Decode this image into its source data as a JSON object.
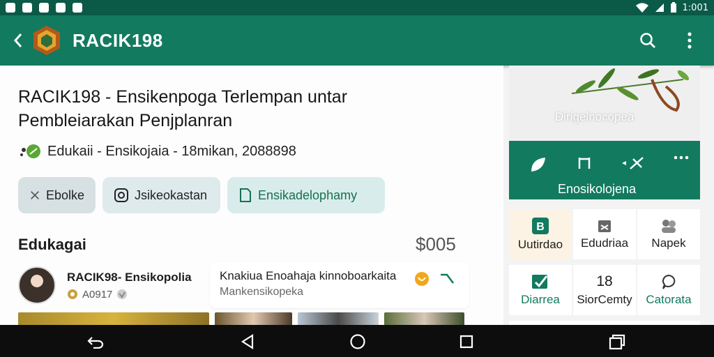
{
  "status_bar": {
    "time": "1:001",
    "colors": {
      "background": "#0a5a47"
    },
    "icons": [
      "notification-icon",
      "wifi-icon",
      "signal-icon",
      "battery-icon"
    ]
  },
  "app_bar": {
    "title": "RACIK198",
    "colors": {
      "background": "#127a5f"
    },
    "icons": [
      "back-icon",
      "app-logo",
      "search-icon",
      "more-vert-icon"
    ]
  },
  "main": {
    "headline": "RACIK198 - Ensikenpoga Terlempan untar Pembleiarakan Penjplanran",
    "meta": "Edukaii - Ensikojaia - 18mikan, 2088898",
    "chips": [
      {
        "label": "Ebolke",
        "icon": "tools-icon"
      },
      {
        "label": "Jsikeokastan",
        "icon": "instagram-icon"
      },
      {
        "label": "Ensikadelophamy",
        "icon": "document-icon"
      }
    ],
    "section": {
      "title": "Edukagai",
      "count": "$005"
    },
    "post": {
      "author": "RACIK98- Ensikopolia",
      "sub": "A0917",
      "card_title": "Knakiua Enoahaja kinnoboarkaita",
      "card_sub": "Mankensikopeka"
    }
  },
  "side": {
    "hero_caption": "Dirigelnocopea",
    "actions_label": "Enosikolojena",
    "actions": [
      "leaf-icon",
      "share-icon",
      "send-icon",
      "more-horiz-icon"
    ],
    "grid_row1": [
      {
        "label": "Uutirdao",
        "icon": "bookmark-b-icon"
      },
      {
        "label": "Edudriaa",
        "icon": "calendar-icon"
      },
      {
        "label": "Napek",
        "icon": "people-icon"
      }
    ],
    "grid_row2": [
      {
        "label": "Diarrea",
        "icon": "checklist-icon"
      },
      {
        "label": "SiorCemty",
        "value": "18"
      },
      {
        "label": "Catorata",
        "icon": "comment-icon"
      }
    ]
  },
  "nav_bar": {
    "buttons": [
      "back-nav-icon",
      "back-triangle-icon",
      "home-circle-icon",
      "recents-square-icon",
      "recent-apps-icon"
    ]
  }
}
